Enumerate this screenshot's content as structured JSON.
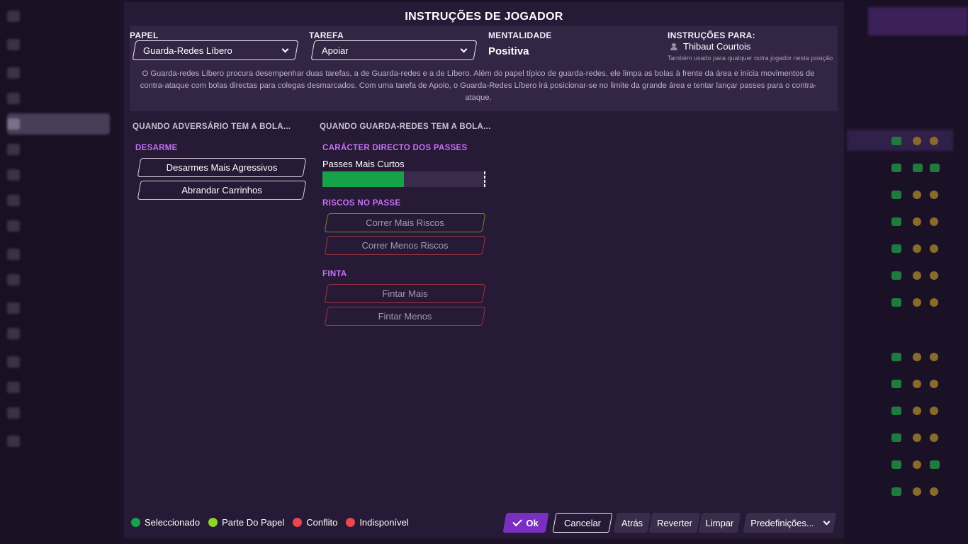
{
  "modal": {
    "title": "INSTRUÇÕES DE JOGADOR",
    "role": {
      "label": "PAPEL",
      "value": "Guarda-Redes Líbero",
      "duty_label": "TAREFA",
      "duty_value": "Apoiar",
      "mentality_label": "MENTALIDADE",
      "mentality_value": "Positiva",
      "instructions_for_label": "INSTRUÇÕES PARA:",
      "player_name": "Thibaut Courtois",
      "player_note": "Também usado para qualquer outra jogador nesta posição",
      "description": "O Guarda-redes Líbero procura desempenhar duas tarefas, a de Guarda-redes e a de Líbero. Além do papel típico de guarda-redes, ele limpa as bolas à frente da área e inicia movimentos de contra-ataque com bolas directas para colegas desmarcados. Com uma tarefa de Apoio, o Guarda-Redes Líbero irá posicionar-se no limite da grande área e tentar lançar passes para o contra-ataque."
    },
    "opponent_section": {
      "heading": "QUANDO ADVERSÁRIO TEM A BOLA...",
      "tackling": {
        "label": "DESARME",
        "options": [
          "Desarmes Mais Agressivos",
          "Abrandar Carrinhos"
        ]
      }
    },
    "gk_section": {
      "heading": "QUANDO GUARDA-REDES TEM A BOLA...",
      "passing_directness": {
        "label": "CARÁCTER DIRECTO DOS PASSES",
        "value_label": "Passes Mais Curtos",
        "fill": 0.5
      },
      "passing_risk": {
        "label": "RISCOS NO PASSE",
        "options": [
          "Correr Mais Riscos",
          "Correr Menos Riscos"
        ]
      },
      "dribbling": {
        "label": "FINTA",
        "options": [
          "Fintar Mais",
          "Fintar Menos"
        ]
      }
    },
    "legend": [
      {
        "label": "Seleccionado",
        "color": "#15a34a"
      },
      {
        "label": "Parte Do Papel",
        "color": "#8fd428"
      },
      {
        "label": "Conflito",
        "color": "#e8474f"
      },
      {
        "label": "Indisponível",
        "color": "#e8474f"
      }
    ],
    "buttons": {
      "ok": "Ok",
      "cancel": "Cancelar",
      "back": "Atrás",
      "revert": "Reverter",
      "clear": "Limpar",
      "presets": "Predefinições..."
    }
  },
  "colors": {
    "accent": "#7a2fc2",
    "heading_purple": "#c471f5",
    "selected_green": "#15a34a"
  }
}
